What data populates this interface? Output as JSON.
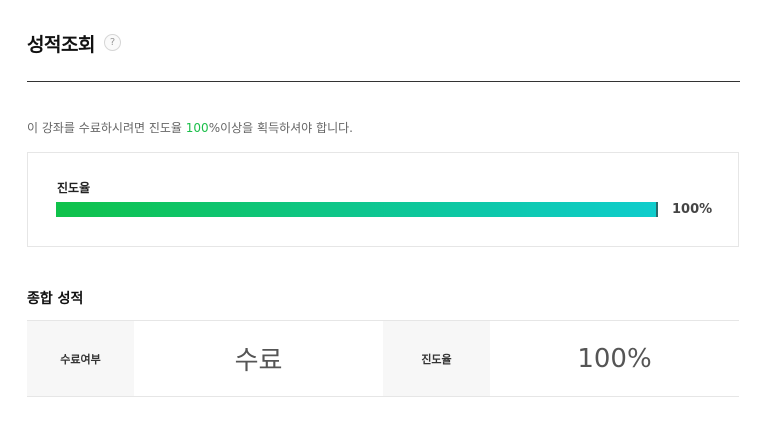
{
  "header": {
    "title": "성적조회",
    "help_glyph": "?"
  },
  "notice": {
    "prefix": "이 강좌를 수료하시려면 진도율 ",
    "required_value": "100",
    "suffix": "%이상을 획득하셔야 합니다."
  },
  "progress": {
    "label": "진도율",
    "value_text": "100%",
    "value_fraction": 1.0
  },
  "summary": {
    "title": "종합 성적",
    "completion_header": "수료여부",
    "completion_value": "수료",
    "progress_header": "진도율",
    "progress_value": "100%"
  },
  "colors": {
    "accent_green": "#1bbf4a",
    "bar_start": "#0fc24a",
    "bar_end": "#0fcdcd"
  }
}
